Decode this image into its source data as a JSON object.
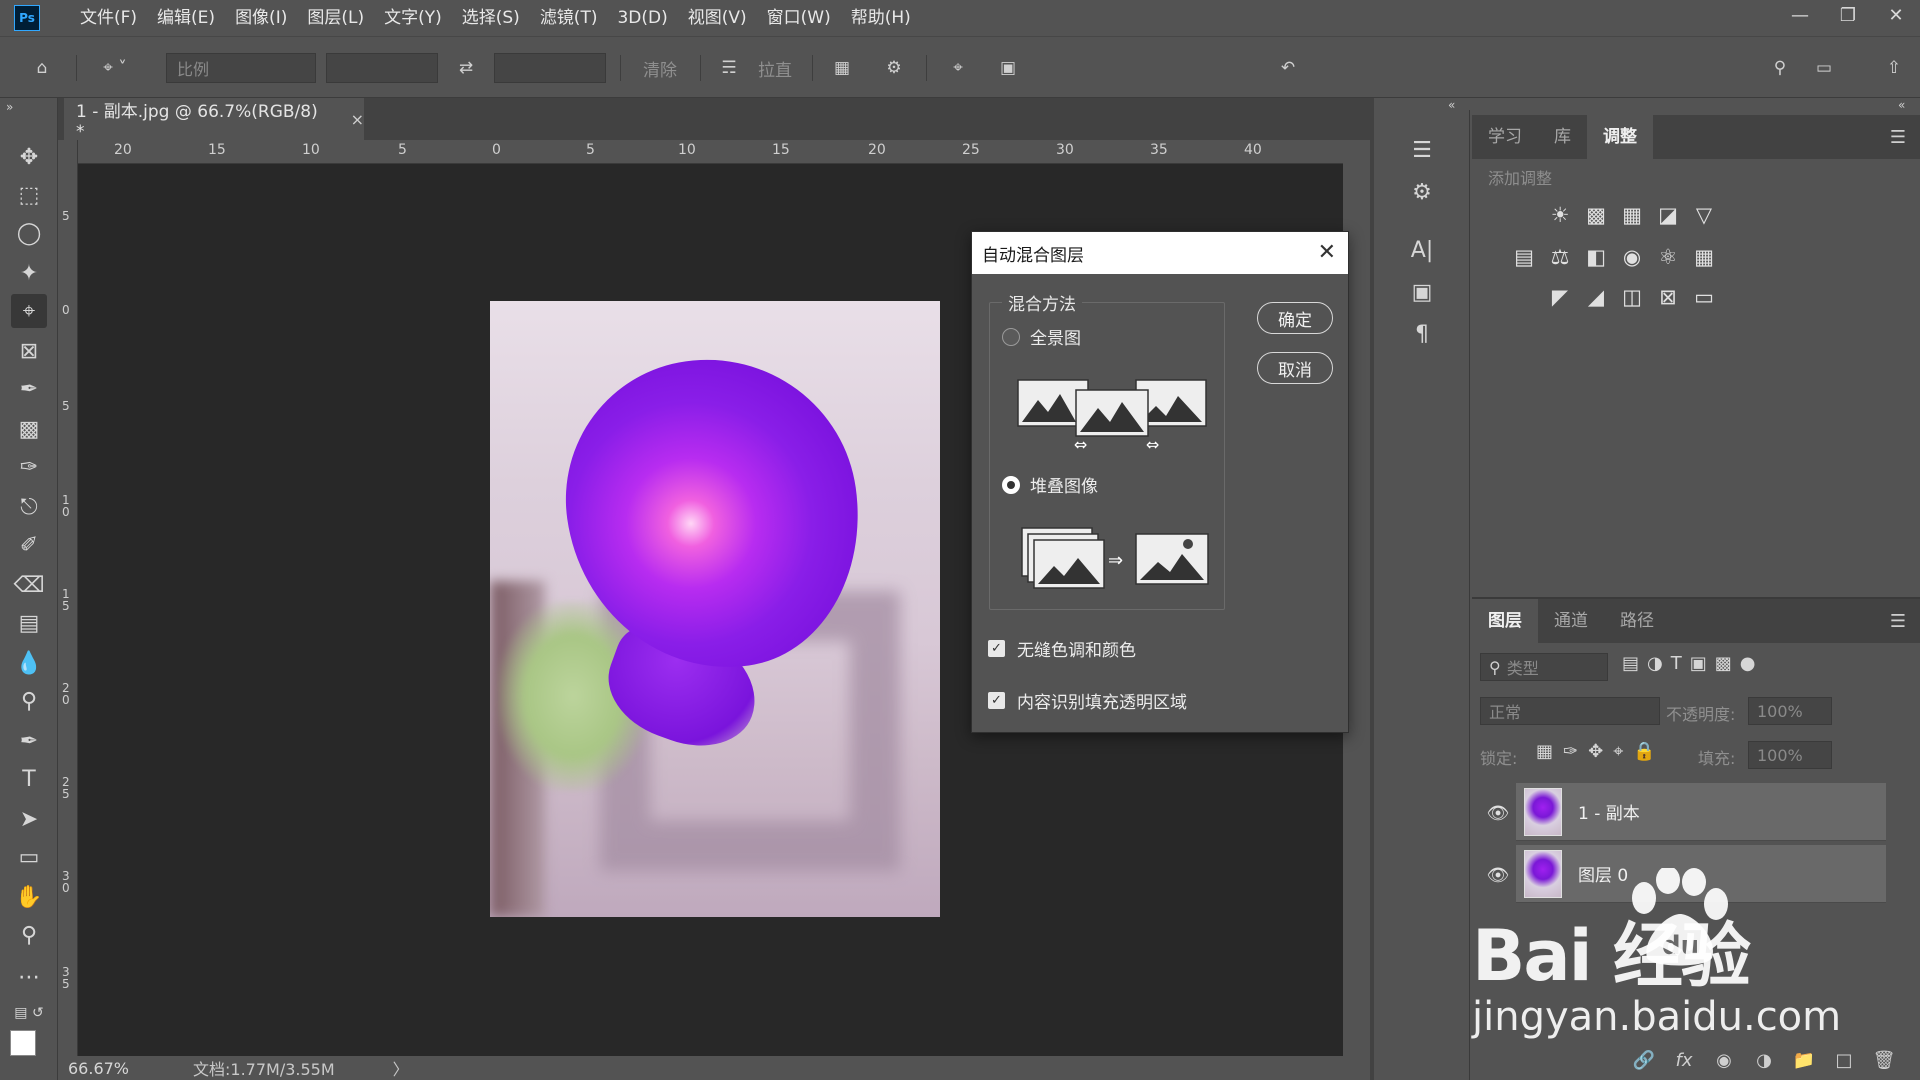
{
  "app": {
    "logo": "Ps",
    "menus": [
      "文件(F)",
      "编辑(E)",
      "图像(I)",
      "图层(L)",
      "文字(Y)",
      "选择(S)",
      "滤镜(T)",
      "3D(D)",
      "视图(V)",
      "窗口(W)",
      "帮助(H)"
    ]
  },
  "options": {
    "ratio_placeholder": "比例",
    "clear_label": "清除",
    "straighten_label": "拉直"
  },
  "document": {
    "tab_title": "1 - 副本.jpg @ 66.7%(RGB/8) *",
    "close_glyph": "×",
    "zoom": "66.67%",
    "doc_info": "文档:1.77M/3.55M",
    "status_arrow": "〉"
  },
  "ruler": {
    "top_labels": [
      "20",
      "15",
      "10",
      "5",
      "0",
      "5",
      "10",
      "15",
      "20",
      "25",
      "30",
      "35",
      "40"
    ],
    "left_labels": [
      "5",
      "0",
      "5",
      "1 0",
      "1 5",
      "2 0",
      "2 5",
      "3 0",
      "3 5"
    ]
  },
  "dialog": {
    "title": "自动混合图层",
    "group_title": "混合方法",
    "option_panorama": "全景图",
    "option_stack": "堆叠图像",
    "selected_method": "堆叠图像",
    "ok_label": "确定",
    "cancel_label": "取消",
    "check_seamless": "无缝色调和颜色",
    "check_seamless_checked": true,
    "check_content_aware": "内容识别填充透明区域",
    "check_content_aware_checked": true
  },
  "panels": {
    "adjust_tabs": [
      "学习",
      "库",
      "调整"
    ],
    "adjust_active": "调整",
    "adjust_title": "添加调整",
    "layers_tabs": [
      "图层",
      "通道",
      "路径"
    ],
    "layers_active": "图层",
    "filter_placeholder": "类型",
    "blend_mode": "正常",
    "opacity_label": "不透明度:",
    "opacity_value": "100%",
    "lock_label": "锁定:",
    "fill_label": "填充:",
    "fill_value": "100%",
    "layers": [
      {
        "name": "1 - 副本",
        "visible": true
      },
      {
        "name": "图层 0",
        "visible": true
      }
    ]
  },
  "watermark": {
    "brand": "Bai   经验",
    "du": "du",
    "url": "jingyan.baidu.com"
  }
}
